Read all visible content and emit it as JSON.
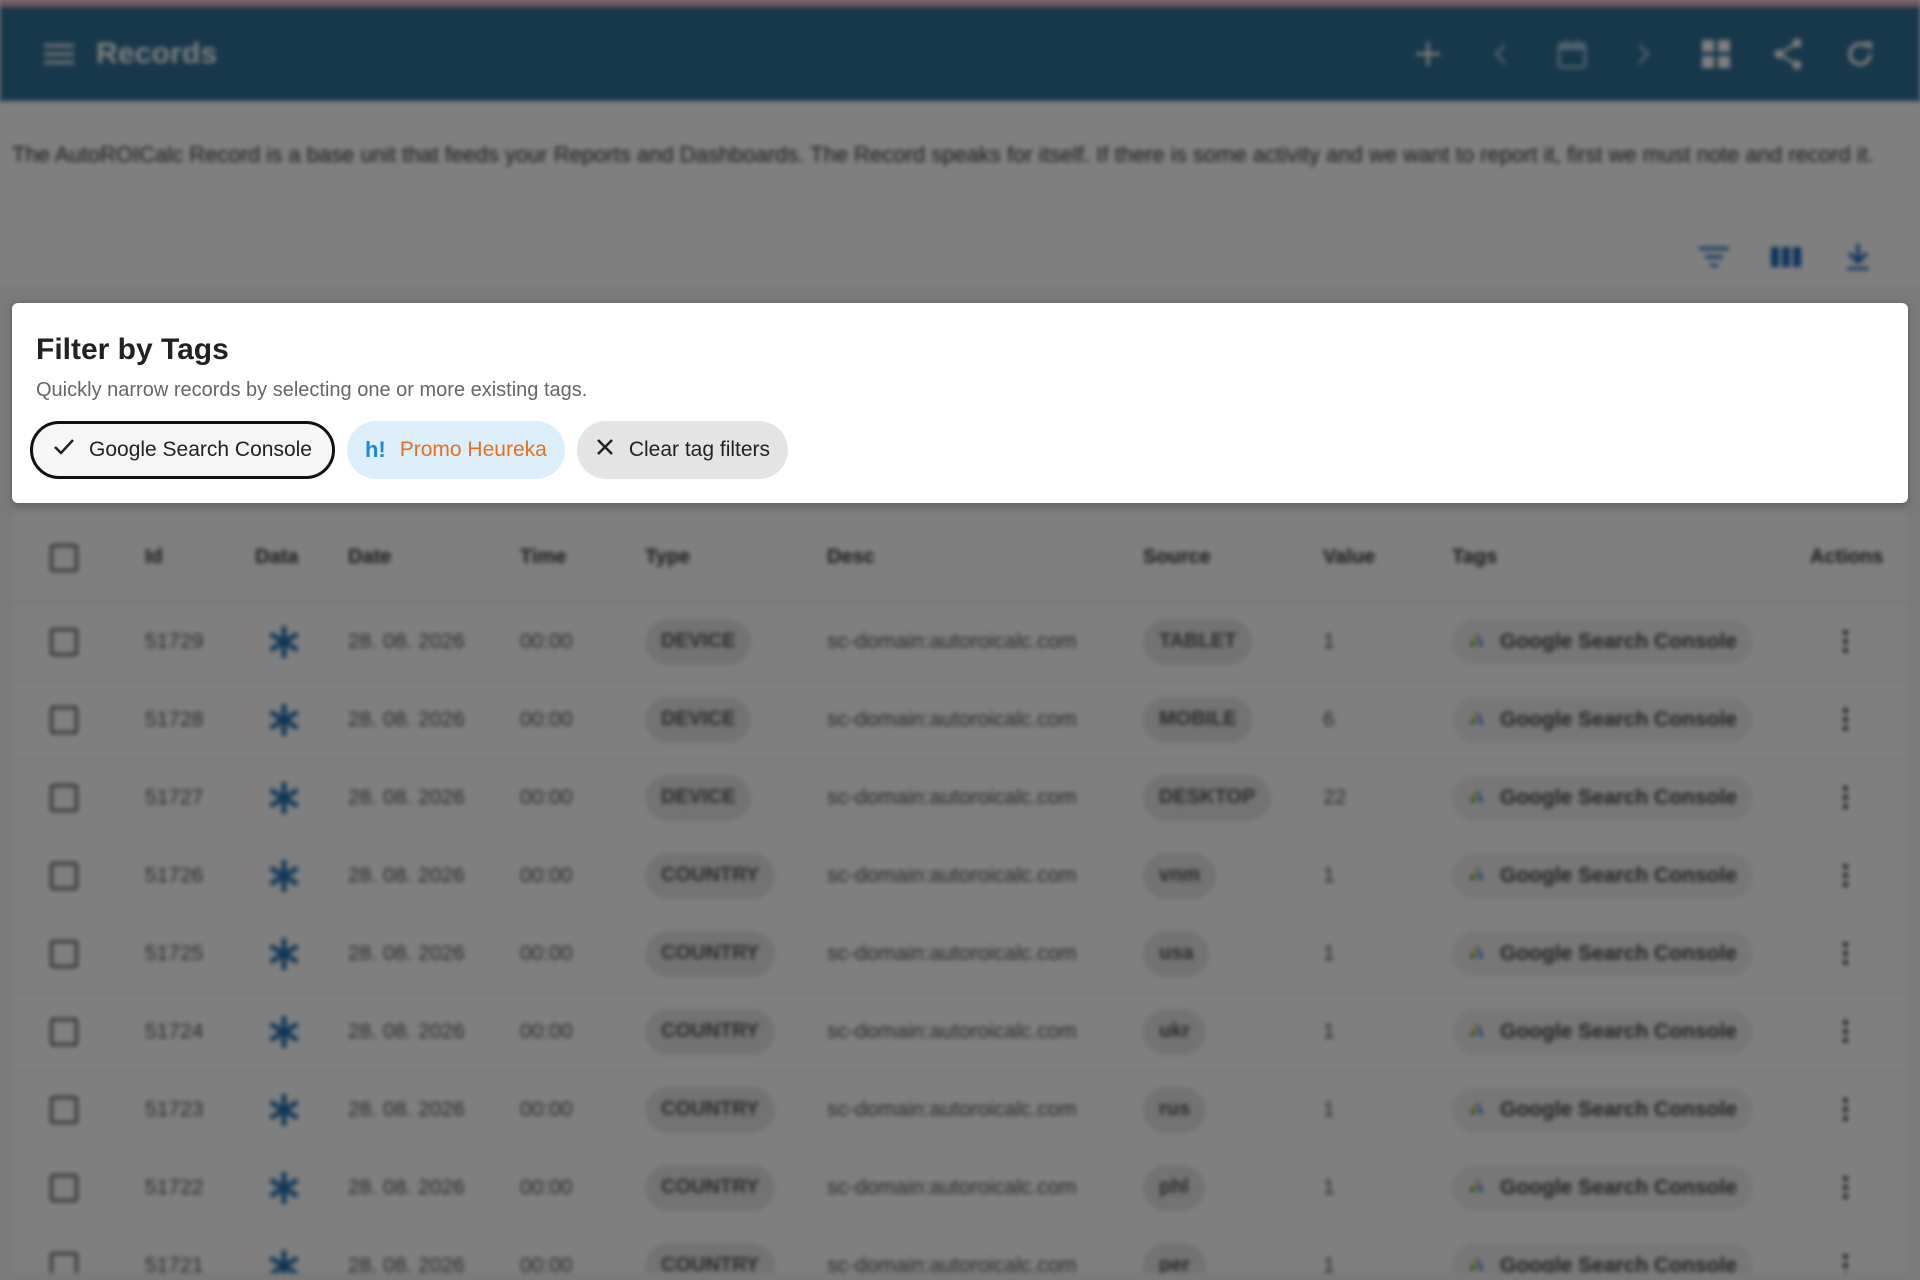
{
  "appbar": {
    "title": "Records",
    "toolbar": [
      "add-icon",
      "chevron-left-icon",
      "calendar-icon",
      "chevron-right-icon",
      "grid-icon",
      "share-icon",
      "refresh-icon"
    ]
  },
  "description": "The AutoROICalc Record is a base unit that feeds your Reports and Dashboards. The Record speaks for itself. If there is some activity and we want to report it, first we must note and record it.",
  "filter_panel": {
    "title": "Filter by Tags",
    "subtitle": "Quickly narrow records by selecting one or more existing tags.",
    "chips": {
      "google": "Google Search Console",
      "heureka_logo": "h!",
      "heureka": "Promo Heureka",
      "clear": "Clear tag filters"
    }
  },
  "table": {
    "headers": {
      "id": "Id",
      "data": "Data",
      "date": "Date",
      "time": "Time",
      "type": "Type",
      "desc": "Desc",
      "source": "Source",
      "value": "Value",
      "tags": "Tags",
      "actions": "Actions"
    },
    "rows": [
      {
        "id": "51729",
        "date": "28. 08. 2026",
        "time": "00:00",
        "type": "DEVICE",
        "desc": "sc-domain:autoroicalc.com",
        "source": "TABLET",
        "value": "1",
        "tag": "Google Search Console"
      },
      {
        "id": "51728",
        "date": "28. 08. 2026",
        "time": "00:00",
        "type": "DEVICE",
        "desc": "sc-domain:autoroicalc.com",
        "source": "MOBILE",
        "value": "6",
        "tag": "Google Search Console"
      },
      {
        "id": "51727",
        "date": "28. 08. 2026",
        "time": "00:00",
        "type": "DEVICE",
        "desc": "sc-domain:autoroicalc.com",
        "source": "DESKTOP",
        "value": "22",
        "tag": "Google Search Console"
      },
      {
        "id": "51726",
        "date": "28. 08. 2026",
        "time": "00:00",
        "type": "COUNTRY",
        "desc": "sc-domain:autoroicalc.com",
        "source": "vnm",
        "value": "1",
        "tag": "Google Search Console"
      },
      {
        "id": "51725",
        "date": "28. 08. 2026",
        "time": "00:00",
        "type": "COUNTRY",
        "desc": "sc-domain:autoroicalc.com",
        "source": "usa",
        "value": "1",
        "tag": "Google Search Console"
      },
      {
        "id": "51724",
        "date": "28. 08. 2026",
        "time": "00:00",
        "type": "COUNTRY",
        "desc": "sc-domain:autoroicalc.com",
        "source": "ukr",
        "value": "1",
        "tag": "Google Search Console"
      },
      {
        "id": "51723",
        "date": "28. 08. 2026",
        "time": "00:00",
        "type": "COUNTRY",
        "desc": "sc-domain:autoroicalc.com",
        "source": "rus",
        "value": "1",
        "tag": "Google Search Console"
      },
      {
        "id": "51722",
        "date": "28. 08. 2026",
        "time": "00:00",
        "type": "COUNTRY",
        "desc": "sc-domain:autoroicalc.com",
        "source": "phl",
        "value": "1",
        "tag": "Google Search Console"
      },
      {
        "id": "51721",
        "date": "28. 08. 2026",
        "time": "00:00",
        "type": "COUNTRY",
        "desc": "sc-domain:autoroicalc.com",
        "source": "per",
        "value": "1",
        "tag": "Google Search Console"
      }
    ]
  },
  "colors": {
    "appbar": "#2f6f96",
    "asterisk": "#1f6fb0",
    "heureka_text": "#e2711d",
    "heureka_logo": "#1e88d8"
  }
}
